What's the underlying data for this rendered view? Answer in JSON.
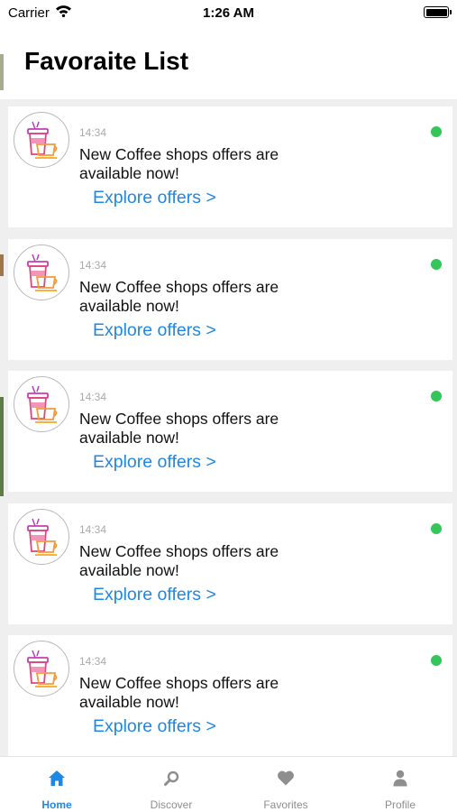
{
  "status_bar": {
    "carrier": "Carrier",
    "time": "1:26 AM"
  },
  "header": {
    "title": "Favoraite List"
  },
  "notifications": [
    {
      "time": "14:34",
      "message": "New Coffee shops offers are available now!",
      "link": "Explore offers >"
    },
    {
      "time": "14:34",
      "message": "New Coffee shops offers are available now!",
      "link": "Explore offers >"
    },
    {
      "time": "14:34",
      "message": "New Coffee shops offers are available now!",
      "link": "Explore offers >"
    },
    {
      "time": "14:34",
      "message": "New Coffee shops offers are available now!",
      "link": "Explore offers >"
    },
    {
      "time": "14:34",
      "message": "New Coffee shops offers are available now!",
      "link": "Explore offers >"
    }
  ],
  "tabs": [
    {
      "label": "Home",
      "icon": "home-icon",
      "active": true
    },
    {
      "label": "Discover",
      "icon": "search-icon",
      "active": false
    },
    {
      "label": "Favorites",
      "icon": "heart-icon",
      "active": false
    },
    {
      "label": "Profile",
      "icon": "person-icon",
      "active": false
    }
  ],
  "colors": {
    "accent": "#1e88e5",
    "unread_dot": "#33c759",
    "background": "#efefef",
    "inactive_tab": "#8e8e8e"
  }
}
